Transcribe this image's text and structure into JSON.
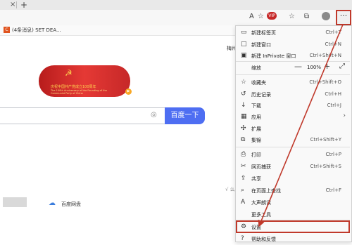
{
  "titlebar": {
    "tab_close": "×",
    "new_tab": "+"
  },
  "toolbar": {
    "icons": [
      "read-aloud-icon",
      "favorites-star-icon",
      "extension-badge-icon",
      "favorites-list-icon",
      "collections-icon",
      "profile-avatar-icon",
      "more-menu-icon"
    ],
    "badge_text": "VIP",
    "more_label": "···"
  },
  "bookmark": {
    "icon_text": "C",
    "label": "(4条消息) SET DEA..."
  },
  "page": {
    "top_right": "梅州",
    "banner_title": "庆祝中国共产党成立100周年",
    "banner_subtitle": "The 100th Anniversary of the Founding of the Communist Party of China",
    "search_button": "百度一下",
    "baidu_pan": "百度网盘",
    "side_text": "√ 么"
  },
  "menu": {
    "items": [
      {
        "icon": "new-tab-icon",
        "label": "新建标签页",
        "shortcut": "Ctrl+T"
      },
      {
        "icon": "new-window-icon",
        "label": "新建窗口",
        "shortcut": "Ctrl+N"
      },
      {
        "icon": "inprivate-icon",
        "label": "新建 InPrivate 窗口",
        "shortcut": "Ctrl+Shift+N"
      }
    ],
    "zoom": {
      "label": "缩放",
      "minus": "—",
      "value": "100%",
      "plus": "+",
      "fullscreen": "⤢"
    },
    "items2": [
      {
        "icon": "favorites-icon",
        "label": "收藏夹",
        "shortcut": "Ctrl+Shift+O"
      },
      {
        "icon": "history-icon",
        "label": "历史记录",
        "shortcut": "Ctrl+H"
      },
      {
        "icon": "download-icon",
        "label": "下载",
        "shortcut": "Ctrl+J"
      },
      {
        "icon": "apps-icon",
        "label": "应用",
        "shortcut": ""
      },
      {
        "icon": "extensions-icon",
        "label": "扩展",
        "shortcut": ""
      },
      {
        "icon": "collections-icon",
        "label": "集锦",
        "shortcut": "Ctrl+Shift+Y"
      }
    ],
    "items3": [
      {
        "icon": "print-icon",
        "label": "打印",
        "shortcut": "Ctrl+P"
      },
      {
        "icon": "web-capture-icon",
        "label": "网页捕获",
        "shortcut": "Ctrl+Shift+S"
      },
      {
        "icon": "share-icon",
        "label": "共享",
        "shortcut": ""
      },
      {
        "icon": "find-icon",
        "label": "在页面上查找",
        "shortcut": "Ctrl+F"
      },
      {
        "icon": "read-aloud-icon",
        "label": "大声朗读",
        "shortcut": ""
      },
      {
        "icon": "more-tools-icon",
        "label": "更多工具",
        "shortcut": ""
      }
    ],
    "settings": {
      "icon": "settings-icon",
      "label": "设置"
    },
    "help": {
      "icon": "help-icon",
      "label": "帮助和反馈"
    }
  },
  "colors": {
    "accent": "#4e6ef2",
    "highlight": "#c0392b",
    "banner": "#c62828"
  }
}
